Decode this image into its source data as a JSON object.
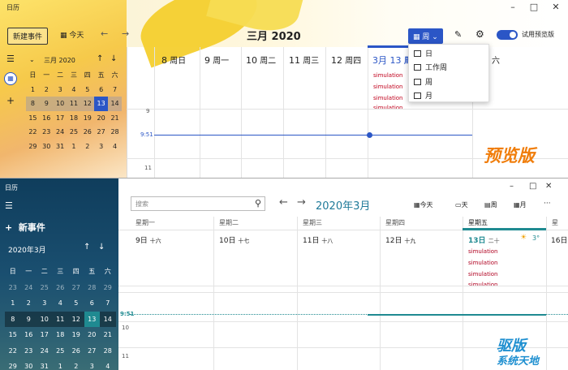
{
  "top": {
    "app_title": "日历",
    "new_event": "新建事件",
    "today_label": "今天",
    "month_title": "三月 2020",
    "view_label": "周",
    "try_preview": "试用预览版",
    "preview_badge": "预览版",
    "mini_cal": {
      "title": "三月 2020",
      "weekdays": [
        "日",
        "一",
        "二",
        "三",
        "四",
        "五",
        "六"
      ],
      "rows": [
        [
          "1",
          "2",
          "3",
          "4",
          "5",
          "6",
          "7"
        ],
        [
          "8",
          "9",
          "10",
          "11",
          "12",
          "13",
          "14"
        ],
        [
          "15",
          "16",
          "17",
          "18",
          "19",
          "20",
          "21"
        ],
        [
          "22",
          "23",
          "24",
          "25",
          "26",
          "27",
          "28"
        ],
        [
          "29",
          "30",
          "31",
          "1",
          "2",
          "3",
          "4"
        ]
      ]
    },
    "days": [
      {
        "num": "8",
        "name": "周日"
      },
      {
        "num": "9",
        "name": "周一"
      },
      {
        "num": "10",
        "name": "周二"
      },
      {
        "num": "11",
        "name": "周三"
      },
      {
        "num": "12",
        "name": "周四"
      },
      {
        "num": "3月 13",
        "name": "周五"
      },
      {
        "num": "",
        "name": "六"
      }
    ],
    "events": [
      "simulation",
      "simulation",
      "simulation",
      "simulation"
    ],
    "time_now": "9:51",
    "hour_labels": [
      "9",
      "11"
    ],
    "dropdown": [
      "日",
      "工作周",
      "周",
      "月"
    ]
  },
  "bottom": {
    "app_title": "日历",
    "new_event": "新事件",
    "search_placeholder": "搜索",
    "month_title": "2020年3月",
    "toolbar": {
      "today": "今天",
      "day": "天",
      "workweek": "周",
      "month": "月",
      "more": "···"
    },
    "mini_cal": {
      "title": "2020年3月",
      "weekdays": [
        "日",
        "一",
        "二",
        "三",
        "四",
        "五",
        "六"
      ],
      "rows": [
        [
          "23",
          "24",
          "25",
          "26",
          "27",
          "28",
          "29"
        ],
        [
          "1",
          "2",
          "3",
          "4",
          "5",
          "6",
          "7"
        ],
        [
          "8",
          "9",
          "10",
          "11",
          "12",
          "13",
          "14"
        ],
        [
          "15",
          "16",
          "17",
          "18",
          "19",
          "20",
          "21"
        ],
        [
          "22",
          "23",
          "24",
          "25",
          "26",
          "27",
          "28"
        ],
        [
          "29",
          "30",
          "31",
          "1",
          "2",
          "3",
          "4"
        ]
      ]
    },
    "day_headers": [
      "星期一",
      "星期二",
      "星期三",
      "星期四",
      "星期五",
      "星"
    ],
    "dates": [
      {
        "day": "9日",
        "lunar": "十六"
      },
      {
        "day": "10日",
        "lunar": "十七"
      },
      {
        "day": "11日",
        "lunar": "十八"
      },
      {
        "day": "12日",
        "lunar": "十九"
      },
      {
        "day": "13日",
        "lunar": "二十"
      },
      {
        "day": "16日",
        "lunar": ""
      }
    ],
    "weather": "3°",
    "events": [
      "simulation",
      "simulation",
      "simulation",
      "simulation"
    ],
    "time_now": "9:51",
    "hour_labels": [
      "10",
      "11"
    ],
    "watermark": {
      "a": "驱版",
      "b": "系统天地"
    }
  }
}
